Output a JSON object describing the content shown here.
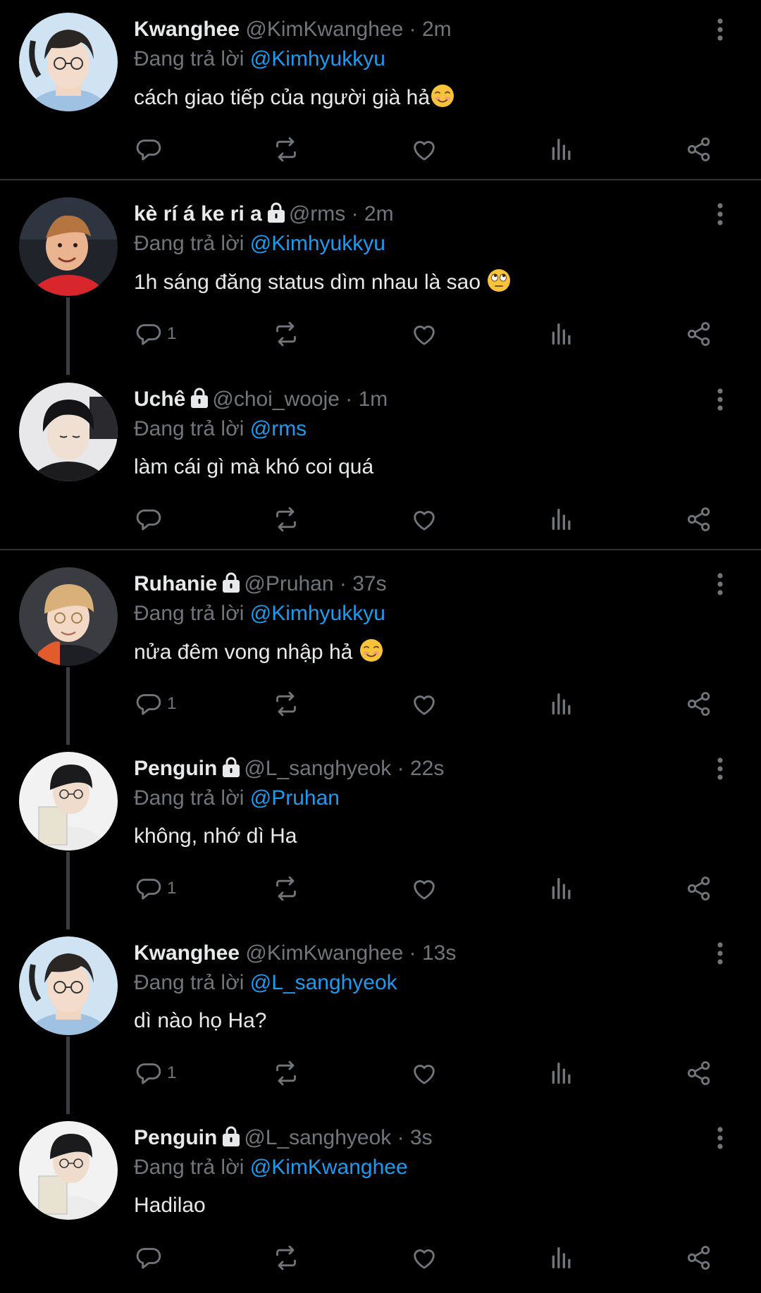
{
  "reply_prefix": "Đang trả lời",
  "colors": {
    "background": "#000000",
    "text": "#e7e9ea",
    "muted": "#71767b",
    "mention": "#1d9bf0",
    "divider": "#2f3336",
    "thread_line": "#3a3d41"
  },
  "tweets": [
    {
      "name": "Kwanghee",
      "handle": "@KimKwanghee",
      "time": "2m",
      "locked": false,
      "reply_to": "@Kimhyukkyu",
      "text": "cách giao tiếp của người già hả",
      "emoji": "smiling-face-icon",
      "reply_count": "",
      "thread_line": false,
      "divider_after": true,
      "avatar": "kwanghee-avatar"
    },
    {
      "name": "kè rí á ke ri a",
      "handle": "@rms",
      "time": "2m",
      "locked": true,
      "reply_to": "@Kimhyukkyu",
      "text": "1h sáng đăng status dìm nhau là sao ",
      "emoji": "eye-roll-face-icon",
      "reply_count": "1",
      "thread_line": true,
      "divider_after": false,
      "avatar": "rms-avatar"
    },
    {
      "name": "Uchê",
      "handle": "@choi_wooje",
      "time": "1m",
      "locked": true,
      "reply_to": "@rms",
      "text": "làm cái gì mà khó coi quá",
      "emoji": "",
      "reply_count": "",
      "thread_line": false,
      "divider_after": true,
      "avatar": "wooje-avatar"
    },
    {
      "name": "Ruhanie",
      "handle": "@Pruhan",
      "time": "37s",
      "locked": true,
      "reply_to": "@Kimhyukkyu",
      "text": "nửa đêm vong nhập hả ",
      "emoji": "smiling-face-icon",
      "reply_count": "1",
      "thread_line": true,
      "divider_after": false,
      "avatar": "pruhan-avatar"
    },
    {
      "name": "Penguin",
      "handle": "@L_sanghyeok",
      "time": "22s",
      "locked": true,
      "reply_to": "@Pruhan",
      "text": "không, nhớ dì Ha",
      "emoji": "",
      "reply_count": "1",
      "thread_line": true,
      "divider_after": false,
      "avatar": "penguin-avatar"
    },
    {
      "name": "Kwanghee",
      "handle": "@KimKwanghee",
      "time": "13s",
      "locked": false,
      "reply_to": "@L_sanghyeok",
      "text": "dì nào họ Ha?",
      "emoji": "",
      "reply_count": "1",
      "thread_line": true,
      "divider_after": false,
      "avatar": "kwanghee-avatar"
    },
    {
      "name": "Penguin",
      "handle": "@L_sanghyeok",
      "time": "3s",
      "locked": true,
      "reply_to": "@KimKwanghee",
      "text": "Hadilao",
      "emoji": "",
      "reply_count": "",
      "thread_line": false,
      "divider_after": false,
      "avatar": "penguin-avatar"
    }
  ]
}
